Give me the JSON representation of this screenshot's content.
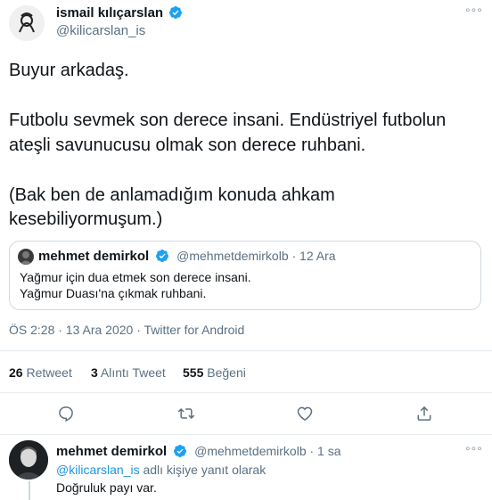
{
  "tweet": {
    "author_name": "ismail kılıçarslan",
    "author_handle": "@kilicarslan_is",
    "more_label": "°°°",
    "lines": [
      "Buyur arkadaş.",
      "Futbolu sevmek son derece insani. Endüstriyel futbolun",
      "ateşli savunucusu olmak son derece ruhbani.",
      "(Bak ben de anlamadığım konuda ahkam",
      "kesebiliyormuşum.)"
    ],
    "quoted": {
      "author_name": "mehmet demirkol",
      "handle_date": "@mehmetdemirkolb · 12 Ara",
      "lines": [
        "Yağmur için dua etmek son derece insani.",
        "Yağmur Duası'na çıkmak ruhbani."
      ]
    },
    "meta": "ÖS 2:28 · 13 Ara 2020 · Twitter for Android",
    "stats": {
      "retweets_count": "26",
      "retweets_label": "Retweet",
      "quotes_count": "3",
      "quotes_label": "Alıntı Tweet",
      "likes_count": "555",
      "likes_label": "Beğeni"
    },
    "actions": [
      "reply-icon",
      "retweet-icon",
      "like-icon",
      "share-icon"
    ]
  },
  "reply": {
    "author_name": "mehmet demirkol",
    "handle_time": "@mehmetdemirkolb · 1 sa",
    "replying_handle": "@kilicarslan_is",
    "replying_suffix": "adlı kişiye yanıt olarak",
    "text": "Doğruluk payı var.",
    "more_label": "°°°"
  },
  "colors": {
    "text": "#0f1419",
    "muted": "#5b7083",
    "link": "#1b95e0",
    "verified": "#1da1f2",
    "divider": "#e6ecf0"
  }
}
